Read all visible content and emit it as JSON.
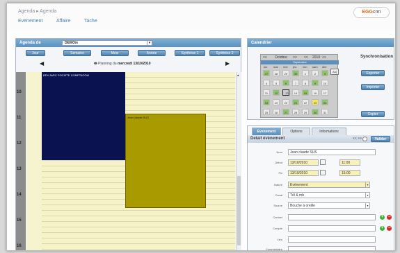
{
  "header": {
    "breadcrumb": "Agenda ▸ Agenda",
    "logo_prefix": "EGG",
    "logo_suffix": "crm",
    "nav": [
      "Evenement",
      "Affaire",
      "Tache"
    ]
  },
  "agenda": {
    "title": "Agenda de",
    "selected_user": "DEMO/e",
    "buttons": [
      "Jour",
      "Semaine",
      "Mois",
      "Année",
      "Synthèse 1",
      "Synthèse 2"
    ],
    "planning_label": "Planning du",
    "planning_date": "mercredi 13/10/2010",
    "hours": [
      "10",
      "11",
      "12",
      "13",
      "14",
      "15",
      "16"
    ],
    "events": [
      {
        "title": "RDV AVEC SOCIETE COMPTACOM"
      },
      {
        "title": "Jean claude SUS"
      }
    ]
  },
  "calendar": {
    "title": "Calendrier",
    "month_label": "Octobre",
    "year_label": "2010",
    "sub_label": "Septembre",
    "today_button": "Auj",
    "day_names": [
      "lun",
      "mar",
      "mer",
      "jeu",
      "ven",
      "sam",
      "dim"
    ],
    "sync_title": "Synchronisation",
    "export_label": "Exporter",
    "import_label": "Importer",
    "sync_label": "Copier",
    "weeks": [
      [
        "27",
        "28",
        "29",
        "30",
        "1",
        "2",
        "3"
      ],
      [
        "4",
        "5",
        "6",
        "7",
        "8",
        "9",
        "10"
      ],
      [
        "11",
        "12",
        "13",
        "14",
        "15",
        "16",
        "17"
      ],
      [
        "18",
        "19",
        "20",
        "21",
        "22",
        "23",
        "24"
      ],
      [
        "25",
        "26",
        "27",
        "28",
        "29",
        "30",
        "31"
      ]
    ]
  },
  "detail": {
    "tabs": [
      "Evenement",
      "Options",
      "Informations"
    ],
    "heading": "Detail évènement",
    "nav_label": "<< >>",
    "save_label": "Valider",
    "fields": {
      "nom_label": "Nom",
      "nom_value": "Jean claude SUS",
      "debut_label": "Début",
      "debut_date": "13/10/2010",
      "debut_time": "11:00",
      "fin_label": "Fin",
      "fin_date": "13/10/2010",
      "fin_time": "15:00",
      "nature_label": "Nature",
      "nature_value": "Evènement",
      "canal_label": "Canal",
      "canal_value": "Tél & mb",
      "source_label": "Source",
      "source_value": "Bouche à oreille",
      "contact_label": "Contact",
      "compte_label": "Compte",
      "lieu_label": "Lieu",
      "commentaire_label": "Commentaire"
    }
  },
  "colors": {
    "event_navy": "#0a124f",
    "event_olive": "#a99a00",
    "header_blue": "#5b8fbd"
  }
}
